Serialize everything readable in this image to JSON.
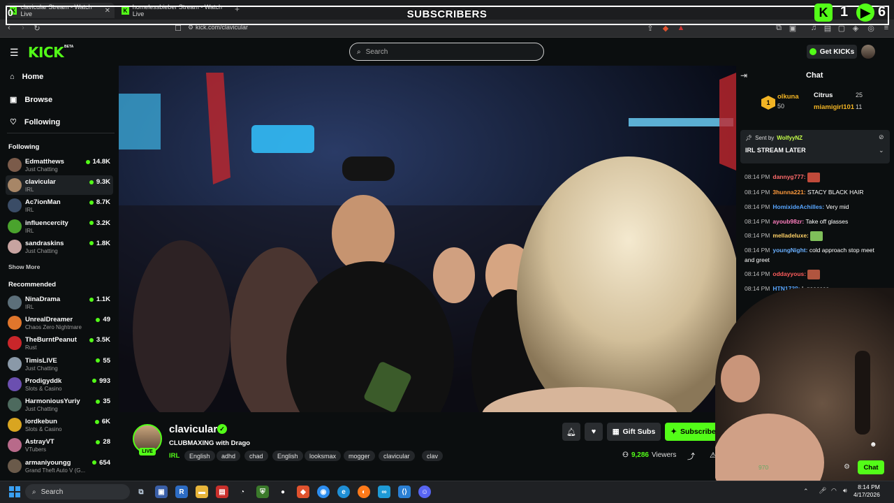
{
  "browser": {
    "tabs": [
      {
        "title": "clavicular Stream - Watch Live",
        "active": true
      },
      {
        "title": "homelessbieber Stream - Watch Live",
        "active": false
      }
    ],
    "url": "kick.com/clavicular"
  },
  "overlay": {
    "title": "SUBSCRIBERS",
    "left_count": "0",
    "kick_count": "1",
    "play_count": "6"
  },
  "header": {
    "logo": "KICK",
    "beta": "BETA",
    "search_placeholder": "Search",
    "get_kicks": "Get KICKs"
  },
  "sidebar": {
    "nav": [
      {
        "label": "Home",
        "icon": "home-icon"
      },
      {
        "label": "Browse",
        "icon": "browse-icon"
      },
      {
        "label": "Following",
        "icon": "heart-icon"
      }
    ],
    "following_title": "Following",
    "following": [
      {
        "name": "Edmatthews",
        "category": "Just Chatting",
        "viewers": "14.8K",
        "color": "#7b5b4a"
      },
      {
        "name": "clavicular",
        "category": "IRL",
        "viewers": "9.3K",
        "color": "#a78667",
        "selected": true
      },
      {
        "name": "Ac7ionMan",
        "category": "IRL",
        "viewers": "8.7K",
        "color": "#3a4c66"
      },
      {
        "name": "influencercity",
        "category": "IRL",
        "viewers": "3.2K",
        "color": "#4aa32d"
      },
      {
        "name": "sandraskins",
        "category": "Just Chatting",
        "viewers": "1.8K",
        "color": "#c7a3a0"
      }
    ],
    "show_more": "Show More",
    "recommended_title": "Recommended",
    "recommended": [
      {
        "name": "NinaDrama",
        "category": "IRL",
        "viewers": "1.1K",
        "color": "#5c6f7a"
      },
      {
        "name": "UnrealDreamer",
        "category": "Chaos Zero Nightmare",
        "viewers": "49",
        "color": "#e0762c"
      },
      {
        "name": "TheBurntPeanut",
        "category": "Rust",
        "viewers": "3.5K",
        "color": "#c9262a"
      },
      {
        "name": "TimisLIVE",
        "category": "Just Chatting",
        "viewers": "55",
        "color": "#8a99a8"
      },
      {
        "name": "Prodigyddk",
        "category": "Slots & Casino",
        "viewers": "993",
        "color": "#6b4fb0"
      },
      {
        "name": "HarmoniousYuriy",
        "category": "Just Chatting",
        "viewers": "35",
        "color": "#4d6a5e"
      },
      {
        "name": "lordkebun",
        "category": "Slots & Casino",
        "viewers": "6K",
        "color": "#d9a520"
      },
      {
        "name": "AstrayVT",
        "category": "VTubers",
        "viewers": "28",
        "color": "#b86a8a"
      },
      {
        "name": "armaniyoungg",
        "category": "Grand Theft Auto V (G...",
        "viewers": "654",
        "color": "#6a5a4a"
      }
    ]
  },
  "stream": {
    "streamer": "clavicular",
    "live": "LIVE",
    "title": "CLUBMAXING with Drago",
    "category": "IRL",
    "tags": [
      "English",
      "adhd",
      "chad",
      "English",
      "looksmax",
      "mogger",
      "clavicular",
      "clav"
    ],
    "gift_subs": "Gift Subs",
    "subscribe": "Subscribe",
    "viewers": "9,286",
    "viewers_label": "Viewers"
  },
  "chat": {
    "title": "Chat",
    "leaderboard": [
      {
        "rank": "1",
        "name": "olkuna",
        "amount": "50"
      },
      {
        "name": "Citrus",
        "amount": "25"
      },
      {
        "name": "miamigirl101",
        "amount": "11"
      }
    ],
    "pinned_by_label": "Sent by",
    "pinned_by": "WolfyyNZ",
    "pinned_text": "IRL STREAM LATER",
    "messages": [
      {
        "time": "08:14 PM",
        "user": "dannyg777:",
        "text": "",
        "color": "#ff6b6b",
        "emote": "#c04a3a"
      },
      {
        "time": "08:14 PM",
        "user": "3hunna221:",
        "text": "STACY BLACK HAIR",
        "color": "#ff9a3c"
      },
      {
        "time": "08:14 PM",
        "user": "HomixideAchilles:",
        "text": "Very mid",
        "color": "#58a6ff"
      },
      {
        "time": "08:14 PM",
        "user": "ayoub98zr:",
        "text": "Take off glasses",
        "color": "#ff7fbf"
      },
      {
        "time": "08:14 PM",
        "user": "melladeluxe:",
        "text": "",
        "color": "#ffd166",
        "emote": "#7fbf5a"
      },
      {
        "time": "08:14 PM",
        "user": "youngNight:",
        "text": "cold approach stop meet and greet",
        "color": "#6ab0ff"
      },
      {
        "time": "08:14 PM",
        "user": "oddayyous:",
        "text": "",
        "color": "#ff5c5c",
        "emote": "#b0553f"
      },
      {
        "time": "08:14 PM",
        "user": "HTN1738:",
        "text": "L goaases",
        "color": "#58a6ff"
      }
    ],
    "chat_button": "Chat",
    "webcam_count_a": "970"
  },
  "taskbar": {
    "search": "Search",
    "time": "8:14 PM",
    "date": "4/17/2026"
  }
}
